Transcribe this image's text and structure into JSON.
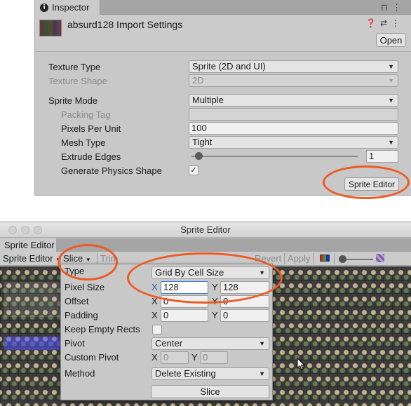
{
  "inspector": {
    "tab_label": "Inspector",
    "lock_icon": "lock-icon",
    "menu_icon": "kebab-menu-icon",
    "asset_title": "absurd128 Import Settings",
    "help_icon": "help-icon",
    "preset_icon": "preset-icon",
    "open_label": "Open",
    "texture_type_label": "Texture Type",
    "texture_type_value": "Sprite (2D and UI)",
    "texture_shape_label": "Texture Shape",
    "texture_shape_value": "2D",
    "sprite_mode_label": "Sprite Mode",
    "sprite_mode_value": "Multiple",
    "packing_tag_label": "Packing Tag",
    "packing_tag_value": "",
    "pixels_per_unit_label": "Pixels Per Unit",
    "pixels_per_unit_value": "100",
    "mesh_type_label": "Mesh Type",
    "mesh_type_value": "Tight",
    "extrude_edges_label": "Extrude Edges",
    "extrude_edges_value": "1",
    "generate_physics_label": "Generate Physics Shape",
    "generate_physics_checked": true,
    "check_mark": "✓",
    "sprite_editor_button": "Sprite Editor"
  },
  "sprite_editor": {
    "window_title": "Sprite Editor",
    "tab_label": "Sprite Editor",
    "mode_dropdown": "Sprite Editor",
    "slice_menu": "Slice",
    "trim_button": "Trim",
    "revert_button": "Revert",
    "apply_button": "Apply",
    "color_channel_icon": "rgb-channel-icon"
  },
  "slice_popup": {
    "type_label": "Type",
    "type_value": "Grid By Cell Size",
    "pixel_size_label": "Pixel Size",
    "pixel_size_x": "128",
    "pixel_size_y": "128",
    "offset_label": "Offset",
    "offset_x": "0",
    "offset_y": "0",
    "padding_label": "Padding",
    "padding_x": "0",
    "padding_y": "0",
    "keep_empty_label": "Keep Empty Rects",
    "pivot_label": "Pivot",
    "pivot_value": "Center",
    "custom_pivot_label": "Custom Pivot",
    "custom_pivot_x": "0",
    "custom_pivot_y": "0",
    "method_label": "Method",
    "method_value": "Delete Existing",
    "slice_button": "Slice",
    "x_label": "X",
    "y_label": "Y"
  },
  "colors": {
    "annotation": "#ee5a24",
    "selection": "#5050ff",
    "panel": "#c8c8c8"
  }
}
